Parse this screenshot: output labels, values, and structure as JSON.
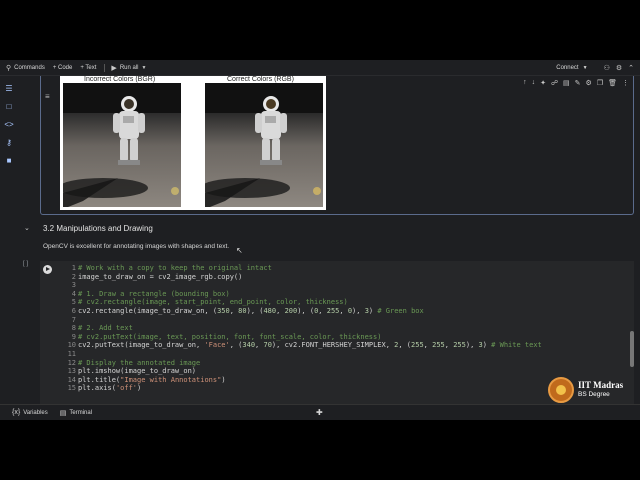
{
  "toolbar": {
    "commands": "Commands",
    "code": "+ Code",
    "text": "+ Text",
    "run_all": "Run all",
    "connect": "Connect"
  },
  "output": {
    "left_title": "Incorrect Colors (BGR)",
    "right_title": "Correct Colors (RGB)"
  },
  "section": {
    "title": "3.2 Manipulations and Drawing",
    "text": "OpenCV is excellent for annotating images with shapes and text."
  },
  "cell": {
    "exec_count": "[ ]"
  },
  "code_lines": [
    {
      "n": "1",
      "parts": [
        {
          "c": "cm",
          "t": "# Work with a copy to keep the original intact"
        }
      ]
    },
    {
      "n": "2",
      "parts": [
        {
          "c": "tx",
          "t": "image_to_draw_on = cv2_image_rgb.copy()"
        }
      ]
    },
    {
      "n": "3",
      "parts": []
    },
    {
      "n": "4",
      "parts": [
        {
          "c": "cm",
          "t": "# 1. Draw a rectangle (bounding box)"
        }
      ]
    },
    {
      "n": "5",
      "parts": [
        {
          "c": "cm",
          "t": "# cv2.rectangle(image, start_point, end_point, color, thickness)"
        }
      ]
    },
    {
      "n": "6",
      "parts": [
        {
          "c": "tx",
          "t": "cv2.rectangle(image_to_draw_on, ("
        },
        {
          "c": "nm",
          "t": "350"
        },
        {
          "c": "tx",
          "t": ", "
        },
        {
          "c": "nm",
          "t": "80"
        },
        {
          "c": "tx",
          "t": "), ("
        },
        {
          "c": "nm",
          "t": "480"
        },
        {
          "c": "tx",
          "t": ", "
        },
        {
          "c": "nm",
          "t": "200"
        },
        {
          "c": "tx",
          "t": "), ("
        },
        {
          "c": "nm",
          "t": "0"
        },
        {
          "c": "tx",
          "t": ", "
        },
        {
          "c": "nm",
          "t": "255"
        },
        {
          "c": "tx",
          "t": ", "
        },
        {
          "c": "nm",
          "t": "0"
        },
        {
          "c": "tx",
          "t": "), "
        },
        {
          "c": "nm",
          "t": "3"
        },
        {
          "c": "tx",
          "t": ") "
        },
        {
          "c": "cm",
          "t": "# Green box"
        }
      ]
    },
    {
      "n": "7",
      "parts": []
    },
    {
      "n": "8",
      "parts": [
        {
          "c": "cm",
          "t": "# 2. Add text"
        }
      ]
    },
    {
      "n": "9",
      "parts": [
        {
          "c": "cm",
          "t": "# cv2.putText(image, text, position, font, font_scale, color, thickness)"
        }
      ]
    },
    {
      "n": "10",
      "parts": [
        {
          "c": "tx",
          "t": "cv2.putText(image_to_draw_on, "
        },
        {
          "c": "st",
          "t": "'Face'"
        },
        {
          "c": "tx",
          "t": ", ("
        },
        {
          "c": "nm",
          "t": "340"
        },
        {
          "c": "tx",
          "t": ", "
        },
        {
          "c": "nm",
          "t": "70"
        },
        {
          "c": "tx",
          "t": "), cv2.FONT_HERSHEY_SIMPLEX, "
        },
        {
          "c": "nm",
          "t": "2"
        },
        {
          "c": "tx",
          "t": ", ("
        },
        {
          "c": "nm",
          "t": "255"
        },
        {
          "c": "tx",
          "t": ", "
        },
        {
          "c": "nm",
          "t": "255"
        },
        {
          "c": "tx",
          "t": ", "
        },
        {
          "c": "nm",
          "t": "255"
        },
        {
          "c": "tx",
          "t": "), "
        },
        {
          "c": "nm",
          "t": "3"
        },
        {
          "c": "tx",
          "t": ") "
        },
        {
          "c": "cm",
          "t": "# White text"
        }
      ]
    },
    {
      "n": "11",
      "parts": []
    },
    {
      "n": "12",
      "parts": [
        {
          "c": "cm",
          "t": "# Display the annotated image"
        }
      ]
    },
    {
      "n": "13",
      "parts": [
        {
          "c": "tx",
          "t": "plt.imshow(image_to_draw_on)"
        }
      ]
    },
    {
      "n": "14",
      "parts": [
        {
          "c": "tx",
          "t": "plt.title("
        },
        {
          "c": "st",
          "t": "\"Image with Annotations\""
        },
        {
          "c": "tx",
          "t": ")"
        }
      ]
    },
    {
      "n": "15",
      "parts": [
        {
          "c": "tx",
          "t": "plt.axis("
        },
        {
          "c": "st",
          "t": "'off'"
        },
        {
          "c": "tx",
          "t": ")"
        }
      ]
    }
  ],
  "bottom": {
    "variables": "Variables",
    "terminal": "Terminal"
  },
  "logo": {
    "line1": "IIT Madras",
    "line2": "BS Degree"
  }
}
